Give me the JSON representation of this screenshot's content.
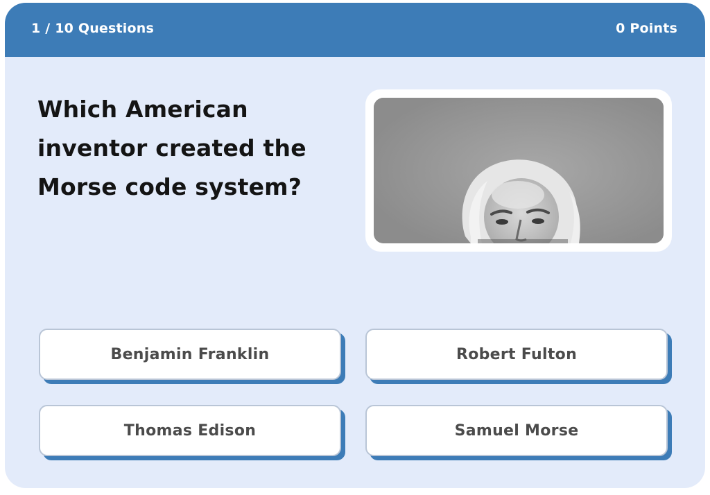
{
  "header": {
    "progress": "1 / 10 Questions",
    "points": "0 Points",
    "color": "#3d7cb7"
  },
  "question": {
    "text": "Which American inventor created the Morse code system?"
  },
  "image": {
    "alt": "Black and white portrait photograph of an elderly man with white hair"
  },
  "answers": [
    "Benjamin Franklin",
    "Robert Fulton",
    "Thomas Edison",
    "Samuel Morse"
  ],
  "colors": {
    "card_background": "#e3ebfa",
    "button_shadow": "#3d7cb7",
    "question_text": "#141414"
  }
}
